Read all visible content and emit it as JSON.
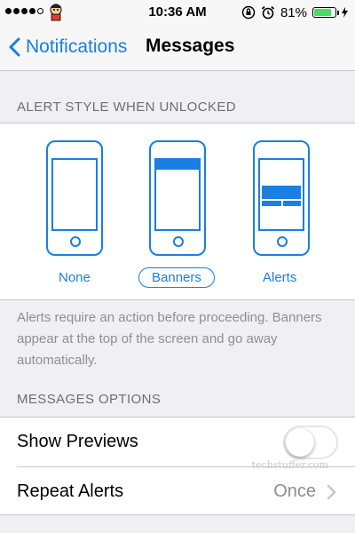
{
  "status_bar": {
    "signal_dots": [
      true,
      true,
      true,
      true,
      false
    ],
    "time": "10:36 AM",
    "icons": [
      "screen-rotation-lock-icon",
      "alarm-icon"
    ],
    "battery_percent": "81%",
    "battery_level": 0.81,
    "battery_color": "#4cd964"
  },
  "nav": {
    "back_label": "Notifications",
    "title": "Messages",
    "accent_color": "#1a7ee3"
  },
  "alert_style": {
    "header": "ALERT STYLE WHEN UNLOCKED",
    "options": [
      {
        "label": "None",
        "selected": false
      },
      {
        "label": "Banners",
        "selected": true
      },
      {
        "label": "Alerts",
        "selected": false
      }
    ],
    "footer": "Alerts require an action before proceeding. Banners appear at the top of the screen and go away automatically."
  },
  "messages_options": {
    "header": "MESSAGES OPTIONS",
    "show_previews": {
      "label": "Show Previews",
      "enabled": false
    },
    "repeat_alerts": {
      "label": "Repeat Alerts",
      "value": "Once"
    }
  },
  "watermark": "techstuffer.com"
}
